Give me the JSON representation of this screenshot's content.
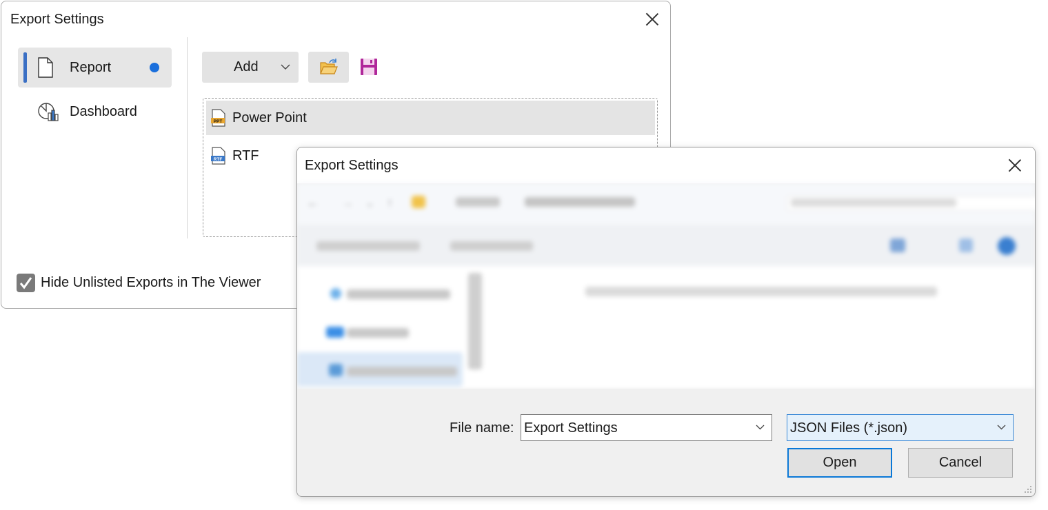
{
  "main_dialog": {
    "title": "Export Settings",
    "nav": [
      {
        "label": "Report",
        "icon": "page-icon",
        "active": true
      },
      {
        "label": "Dashboard",
        "icon": "dashboard-icon",
        "active": false
      }
    ],
    "toolbar": {
      "add_label": "Add",
      "open_icon": "folder-open-icon",
      "save_icon": "save-icon"
    },
    "exports": [
      {
        "label": "Power Point",
        "icon": "ppt-file-icon",
        "icon_text": "PPT",
        "selected": true
      },
      {
        "label": "RTF",
        "icon": "rtf-file-icon",
        "icon_text": "RTF",
        "selected": false
      }
    ],
    "hide_unlisted": {
      "label": "Hide Unlisted Exports in The Viewer",
      "checked": true
    }
  },
  "file_dialog": {
    "title": "Export Settings",
    "file_name_label": "File name:",
    "file_name_value": "Export Settings",
    "filter_value": "JSON Files (*.json)",
    "open_label": "Open",
    "cancel_label": "Cancel"
  },
  "colors": {
    "accent": "#3a6fc4",
    "active_dot": "#1a6fdc",
    "save_icon": "#b0279a",
    "folder_icon": "#e8a630",
    "focus_border": "#0a78d7"
  }
}
